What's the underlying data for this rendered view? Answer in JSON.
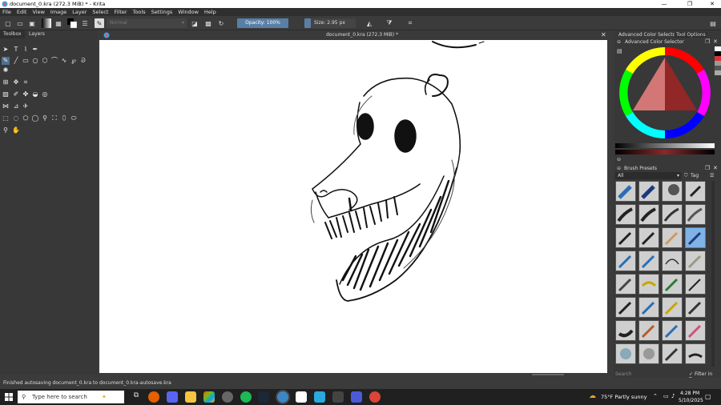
{
  "window": {
    "title": "document_0.kra (272.3 MiB) * - Krita",
    "minimize_glyph": "—",
    "maximize_glyph": "❐",
    "close_glyph": "✕"
  },
  "menu": [
    "File",
    "Edit",
    "View",
    "Image",
    "Layer",
    "Select",
    "Filter",
    "Tools",
    "Settings",
    "Window",
    "Help"
  ],
  "toolbar": {
    "blend_mode": "Normal",
    "opacity": "Opacity: 100%",
    "size": "Size: 2.95 px"
  },
  "left_panel": {
    "tabs": [
      "Toolbox",
      "Layers"
    ]
  },
  "document": {
    "tab_title": "document_0.kra (272.3 MiB) *",
    "close_glyph": "✕"
  },
  "right_panel": {
    "top_tabs": [
      "Advanced Color Selector",
      "Tool Options"
    ],
    "color_selector_title": "Advanced Color Selector",
    "brush_presets_title": "Brush Presets",
    "filter_all": "All",
    "tag_label": "Tag",
    "search_placeholder": "Search",
    "filter_in_tag": "Filter in Tag"
  },
  "status": {
    "message": "Finished autosaving document_0.kra to document_0.kra-autosave.kra"
  },
  "taskbar": {
    "search_placeholder": "Type here to search",
    "weather": "75°F  Partly sunny",
    "time": "4:28 PM",
    "date": "5/10/2025"
  },
  "colors": {
    "accent": "#3d86c6",
    "panel": "#383838",
    "canvas": "#ffffff"
  }
}
